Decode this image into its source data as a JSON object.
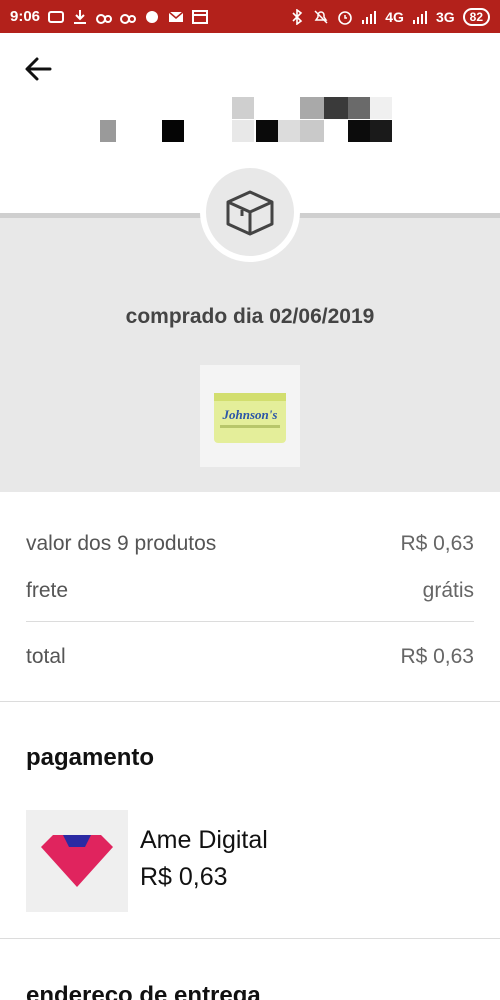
{
  "status_bar": {
    "time": "9:06",
    "network_1": "4G",
    "network_2": "3G",
    "battery": "82"
  },
  "order": {
    "purchased_label": "comprado dia 02/06/2019",
    "product_thumbnail_text": "Johnson's"
  },
  "summary": {
    "products_label": "valor dos 9 produtos",
    "products_value": "R$ 0,63",
    "shipping_label": "frete",
    "shipping_value": "grátis",
    "total_label": "total",
    "total_value": "R$ 0,63"
  },
  "payment": {
    "section_title": "pagamento",
    "method_name": "Ame Digital",
    "method_amount": "R$ 0,63"
  },
  "delivery": {
    "section_title": "endereço de entrega"
  },
  "colors": {
    "status_bar": "#b3211b",
    "band": "#e8e8e8",
    "ame_logo": "#e0245e",
    "ame_logo_accent": "#2b2aa3"
  }
}
